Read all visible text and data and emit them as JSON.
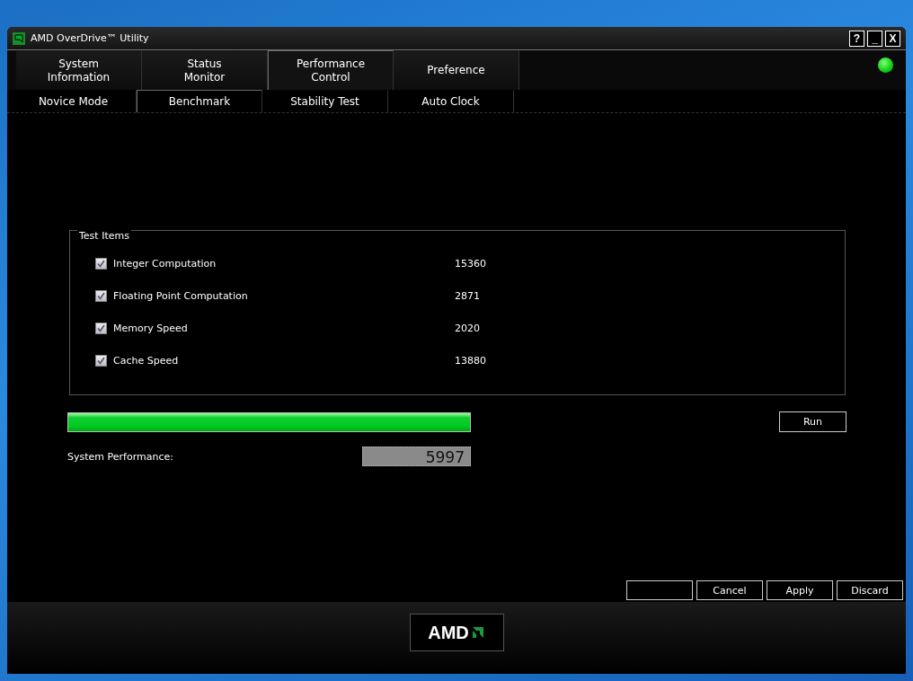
{
  "window": {
    "title": "AMD OverDrive™ Utility",
    "controls": [
      "?",
      "_",
      "X"
    ]
  },
  "tabs": [
    {
      "label": "System\nInformation",
      "selected": false
    },
    {
      "label": "Status\nMonitor",
      "selected": false
    },
    {
      "label": "Performance\nControl",
      "selected": true
    },
    {
      "label": "Preference",
      "selected": false
    }
  ],
  "status_light": {
    "on": true
  },
  "subtabs": [
    {
      "label": "Novice Mode",
      "selected": false
    },
    {
      "label": "Benchmark",
      "selected": true
    },
    {
      "label": "Stability Test",
      "selected": false
    },
    {
      "label": "Auto Clock",
      "selected": false
    }
  ],
  "test_items": {
    "title": "Test Items",
    "items": [
      {
        "label": "Integer Computation",
        "checked": true,
        "score": "15360"
      },
      {
        "label": "Floating Point Computation",
        "checked": true,
        "score": "2871"
      },
      {
        "label": "Memory Speed",
        "checked": true,
        "score": "2020"
      },
      {
        "label": "Cache Speed",
        "checked": true,
        "score": "13880"
      }
    ]
  },
  "progress": {
    "level": 1.0
  },
  "run_button": "Run",
  "system_performance": {
    "label": "System Performance:",
    "value": "5997"
  },
  "buttons": [
    {
      "kind": "blank"
    },
    {
      "kind": "text",
      "label": "Cancel"
    },
    {
      "kind": "text",
      "label": "Apply"
    },
    {
      "kind": "text",
      "label": "Discard"
    }
  ],
  "footer": {
    "logo_text": "AMD"
  }
}
